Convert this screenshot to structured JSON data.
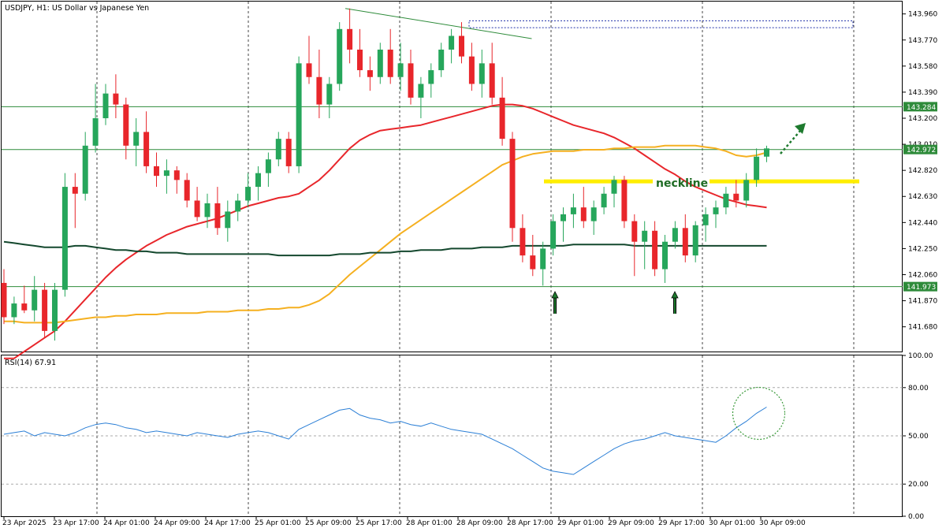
{
  "header": {
    "symbol_title": "USDJPY, H1:  US Dollar vs Japanese Yen",
    "rsi_title": "RSI(14) 67.91"
  },
  "annotations": {
    "neckline": "neckline"
  },
  "colors": {
    "bull": "#26a65b",
    "bear": "#e8262b",
    "ma_fast": "#e8262b",
    "ma_mid": "#f5b020",
    "ma_slow": "#14482e",
    "level": "#2e8b3a",
    "neckline": "#ffee00",
    "rsi": "#2b7fd6",
    "arrow": "#1e7a2e"
  },
  "chart_data": [
    {
      "type": "candlestick",
      "title": "USDJPY, H1:  US Dollar vs Japanese Yen",
      "ylim": [
        141.5,
        144.05
      ],
      "price_ticks": [
        "143.960",
        "143.770",
        "143.580",
        "143.390",
        "143.200",
        "143.010",
        "142.820",
        "142.630",
        "142.440",
        "142.250",
        "142.060",
        "141.870",
        "141.680"
      ],
      "price_tick_values": [
        143.96,
        143.77,
        143.58,
        143.39,
        143.2,
        143.01,
        142.82,
        142.63,
        142.44,
        142.25,
        142.06,
        141.87,
        141.68
      ],
      "highlighted_levels": [
        {
          "label": "143.284",
          "value": 143.284
        },
        {
          "label": "142.972",
          "value": 142.972
        },
        {
          "label": "141.973",
          "value": 141.973
        }
      ],
      "neckline": {
        "label": "neckline",
        "value": 142.74
      },
      "resistance_zone": [
        143.86,
        143.91
      ],
      "trendline": {
        "from": [
          4.5,
          144.0
        ],
        "to": [
          70.5,
          143.78
        ]
      },
      "x_labels": [
        "23 Apr 2025",
        "23 Apr 17:00",
        "24 Apr 01:00",
        "24 Apr 09:00",
        "24 Apr 17:00",
        "25 Apr 01:00",
        "25 Apr 09:00",
        "25 Apr 17:00",
        "28 Apr 01:00",
        "28 Apr 09:00",
        "28 Apr 17:00",
        "29 Apr 01:00",
        "29 Apr 09:00",
        "29 Apr 17:00",
        "30 Apr 01:00",
        "30 Apr 09:00"
      ],
      "candles_ohlc": [
        [
          142.0,
          142.1,
          141.7,
          141.75
        ],
        [
          141.75,
          141.9,
          141.7,
          141.85
        ],
        [
          141.85,
          141.98,
          141.78,
          141.8
        ],
        [
          141.8,
          142.05,
          141.72,
          141.95
        ],
        [
          141.95,
          142.0,
          141.6,
          141.65
        ],
        [
          141.65,
          142.0,
          141.58,
          141.95
        ],
        [
          141.95,
          142.8,
          141.9,
          142.7
        ],
        [
          142.7,
          142.8,
          142.4,
          142.65
        ],
        [
          142.65,
          143.1,
          142.6,
          143.0
        ],
        [
          143.0,
          143.45,
          142.95,
          143.2
        ],
        [
          143.2,
          143.45,
          143.15,
          143.38
        ],
        [
          143.38,
          143.52,
          143.2,
          143.3
        ],
        [
          143.3,
          143.35,
          142.9,
          143.0
        ],
        [
          143.0,
          143.2,
          142.85,
          143.1
        ],
        [
          143.1,
          143.25,
          142.8,
          142.85
        ],
        [
          142.85,
          142.95,
          142.7,
          142.78
        ],
        [
          142.78,
          142.9,
          142.65,
          142.82
        ],
        [
          142.82,
          142.85,
          142.65,
          142.75
        ],
        [
          142.75,
          142.8,
          142.55,
          142.6
        ],
        [
          142.6,
          142.7,
          142.45,
          142.48
        ],
        [
          142.48,
          142.65,
          142.4,
          142.58
        ],
        [
          142.58,
          142.7,
          142.35,
          142.4
        ],
        [
          142.4,
          142.6,
          142.3,
          142.52
        ],
        [
          142.52,
          142.65,
          142.45,
          142.6
        ],
        [
          142.6,
          142.8,
          142.55,
          142.7
        ],
        [
          142.7,
          142.85,
          142.6,
          142.8
        ],
        [
          142.8,
          142.95,
          142.7,
          142.9
        ],
        [
          142.9,
          143.1,
          142.85,
          143.05
        ],
        [
          143.05,
          143.1,
          142.8,
          142.85
        ],
        [
          142.85,
          143.65,
          142.8,
          143.6
        ],
        [
          143.6,
          143.8,
          143.45,
          143.5
        ],
        [
          143.5,
          143.7,
          143.2,
          143.3
        ],
        [
          143.3,
          143.5,
          143.2,
          143.45
        ],
        [
          143.45,
          143.9,
          143.4,
          143.85
        ],
        [
          143.85,
          144.0,
          143.6,
          143.7
        ],
        [
          143.7,
          143.85,
          143.5,
          143.55
        ],
        [
          143.55,
          143.65,
          143.4,
          143.5
        ],
        [
          143.5,
          143.75,
          143.45,
          143.7
        ],
        [
          143.7,
          143.85,
          143.45,
          143.5
        ],
        [
          143.5,
          143.75,
          143.4,
          143.6
        ],
        [
          143.6,
          143.7,
          143.3,
          143.35
        ],
        [
          143.35,
          143.5,
          143.2,
          143.45
        ],
        [
          143.45,
          143.6,
          143.35,
          143.55
        ],
        [
          143.55,
          143.75,
          143.5,
          143.7
        ],
        [
          143.7,
          143.85,
          143.6,
          143.8
        ],
        [
          143.8,
          143.9,
          143.6,
          143.65
        ],
        [
          143.65,
          143.75,
          143.4,
          143.45
        ],
        [
          143.45,
          143.7,
          143.35,
          143.6
        ],
        [
          143.6,
          143.75,
          143.3,
          143.35
        ],
        [
          143.35,
          143.5,
          143.0,
          143.05
        ],
        [
          143.05,
          143.1,
          142.3,
          142.4
        ],
        [
          142.4,
          142.5,
          142.15,
          142.2
        ],
        [
          142.2,
          142.35,
          142.05,
          142.1
        ],
        [
          142.1,
          142.3,
          141.98,
          142.25
        ],
        [
          142.25,
          142.5,
          142.2,
          142.45
        ],
        [
          142.45,
          142.55,
          142.3,
          142.5
        ],
        [
          142.5,
          142.65,
          142.4,
          142.55
        ],
        [
          142.55,
          142.7,
          142.4,
          142.45
        ],
        [
          142.45,
          142.6,
          142.35,
          142.55
        ],
        [
          142.55,
          142.7,
          142.5,
          142.65
        ],
        [
          142.65,
          142.78,
          142.55,
          142.75
        ],
        [
          142.75,
          142.78,
          142.4,
          142.45
        ],
        [
          142.45,
          142.5,
          142.05,
          142.3
        ],
        [
          142.3,
          142.45,
          142.1,
          142.38
        ],
        [
          142.38,
          142.45,
          142.05,
          142.1
        ],
        [
          142.1,
          142.35,
          142.0,
          142.3
        ],
        [
          142.3,
          142.45,
          142.25,
          142.4
        ],
        [
          142.4,
          142.5,
          142.15,
          142.2
        ],
        [
          142.2,
          142.45,
          142.15,
          142.42
        ],
        [
          142.42,
          142.55,
          142.3,
          142.5
        ],
        [
          142.5,
          142.6,
          142.4,
          142.55
        ],
        [
          142.55,
          142.7,
          142.5,
          142.65
        ],
        [
          142.65,
          142.75,
          142.55,
          142.6
        ],
        [
          142.6,
          142.8,
          142.55,
          142.75
        ],
        [
          142.75,
          142.98,
          142.7,
          142.92
        ],
        [
          142.92,
          143.0,
          142.88,
          142.98
        ]
      ],
      "series": [
        {
          "name": "MA fast",
          "values": [
            141.45,
            141.45,
            141.5,
            141.55,
            141.6,
            141.65,
            141.72,
            141.8,
            141.88,
            141.96,
            142.04,
            142.11,
            142.17,
            142.22,
            142.27,
            142.31,
            142.35,
            142.38,
            142.41,
            142.43,
            142.45,
            142.47,
            142.5,
            142.53,
            142.56,
            142.58,
            142.6,
            142.62,
            142.63,
            142.65,
            142.7,
            142.75,
            142.82,
            142.9,
            142.98,
            143.04,
            143.08,
            143.11,
            143.12,
            143.13,
            143.14,
            143.15,
            143.17,
            143.19,
            143.21,
            143.23,
            143.25,
            143.27,
            143.29,
            143.3,
            143.3,
            143.29,
            143.27,
            143.24,
            143.21,
            143.18,
            143.15,
            143.13,
            143.11,
            143.09,
            143.06,
            143.02,
            142.98,
            142.93,
            142.88,
            142.83,
            142.79,
            142.74,
            142.7,
            142.67,
            142.64,
            142.61,
            142.59,
            142.57,
            142.56,
            142.55
          ]
        },
        {
          "name": "MA mid",
          "values": [
            141.72,
            141.72,
            141.71,
            141.71,
            141.71,
            141.71,
            141.72,
            141.73,
            141.74,
            141.75,
            141.75,
            141.76,
            141.76,
            141.77,
            141.77,
            141.77,
            141.78,
            141.78,
            141.78,
            141.78,
            141.79,
            141.79,
            141.79,
            141.8,
            141.8,
            141.8,
            141.81,
            141.81,
            141.82,
            141.82,
            141.84,
            141.87,
            141.92,
            141.99,
            142.06,
            142.12,
            142.18,
            142.24,
            142.3,
            142.36,
            142.41,
            142.46,
            142.51,
            142.56,
            142.61,
            142.66,
            142.71,
            142.76,
            142.81,
            142.86,
            142.89,
            142.92,
            142.94,
            142.95,
            142.96,
            142.96,
            142.96,
            142.97,
            142.97,
            142.97,
            142.98,
            142.98,
            142.99,
            142.99,
            142.99,
            143.0,
            143.0,
            143.0,
            143.0,
            142.99,
            142.98,
            142.96,
            142.93,
            142.92,
            142.93,
            142.95
          ]
        },
        {
          "name": "MA slow",
          "values": [
            142.3,
            142.29,
            142.28,
            142.27,
            142.26,
            142.26,
            142.26,
            142.27,
            142.27,
            142.26,
            142.25,
            142.24,
            142.24,
            142.23,
            142.23,
            142.22,
            142.22,
            142.22,
            142.21,
            142.21,
            142.21,
            142.21,
            142.21,
            142.21,
            142.21,
            142.21,
            142.21,
            142.2,
            142.2,
            142.2,
            142.2,
            142.2,
            142.2,
            142.21,
            142.21,
            142.21,
            142.22,
            142.22,
            142.22,
            142.23,
            142.23,
            142.24,
            142.24,
            142.24,
            142.25,
            142.25,
            142.25,
            142.26,
            142.26,
            142.26,
            142.27,
            142.27,
            142.27,
            142.27,
            142.27,
            142.27,
            142.28,
            142.28,
            142.28,
            142.28,
            142.28,
            142.28,
            142.27,
            142.27,
            142.27,
            142.27,
            142.27,
            142.27,
            142.27,
            142.27,
            142.27,
            142.27,
            142.27,
            142.27,
            142.27,
            142.27
          ]
        }
      ]
    },
    {
      "type": "line",
      "title": "RSI(14) 67.91",
      "ylim": [
        0,
        100
      ],
      "y_ticks": [
        "100.00",
        "80.00",
        "50.00",
        "20.00",
        "0.00"
      ],
      "y_tick_values": [
        100,
        80,
        50,
        20,
        0
      ],
      "dashed_levels": [
        80,
        50,
        20
      ],
      "last_value": 67.91,
      "series": [
        {
          "name": "RSI(14)",
          "values": [
            51,
            52,
            53,
            50,
            52,
            51,
            50,
            52,
            55,
            57,
            58,
            57,
            55,
            54,
            52,
            53,
            52,
            51,
            50,
            52,
            51,
            50,
            49,
            51,
            52,
            53,
            52,
            50,
            48,
            54,
            57,
            60,
            63,
            66,
            67,
            63,
            61,
            60,
            58,
            59,
            57,
            56,
            58,
            56,
            54,
            53,
            52,
            51,
            48,
            45,
            42,
            38,
            34,
            30,
            28,
            27,
            26,
            30,
            34,
            38,
            42,
            45,
            47,
            48,
            50,
            52,
            50,
            49,
            48,
            47,
            46,
            50,
            55,
            59,
            64,
            67.91
          ]
        }
      ]
    }
  ]
}
